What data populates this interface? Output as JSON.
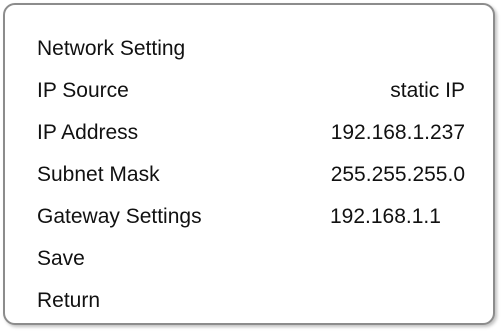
{
  "menu": {
    "title": "Network Setting",
    "ip_source": {
      "label": "IP Source",
      "value": "static IP"
    },
    "ip_address": {
      "label": "IP Address",
      "value": "192.168.1.237"
    },
    "subnet_mask": {
      "label": "Subnet Mask",
      "value": "255.255.255.0"
    },
    "gateway": {
      "label": "Gateway Settings",
      "value": "192.168.1.1"
    },
    "save_label": "Save",
    "return_label": "Return"
  },
  "colors": {
    "border": "#8c8c8c",
    "text": "#111111",
    "background": "#ffffff"
  }
}
